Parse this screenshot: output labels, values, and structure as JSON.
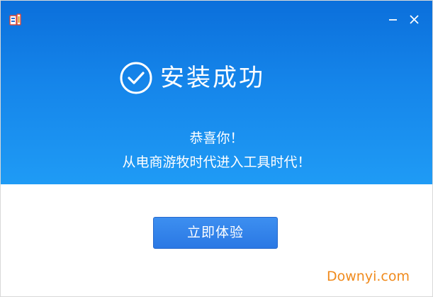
{
  "window": {
    "app_icon": "app-logo-icon",
    "minimize_icon": "minimize-icon",
    "close_icon": "close-icon"
  },
  "hero": {
    "status_icon": "check-circle-icon",
    "title": "安装成功",
    "message_line1": "恭喜你！",
    "message_line2": "从电商游牧时代进入工具时代！"
  },
  "actions": {
    "start_label": "立即体验"
  },
  "watermark": {
    "text": "Downyi.com"
  },
  "colors": {
    "hero_top": "#0b6fdb",
    "hero_bottom": "#1f9bf5",
    "button": "#2a78e4",
    "watermark": "#f08a1c"
  }
}
